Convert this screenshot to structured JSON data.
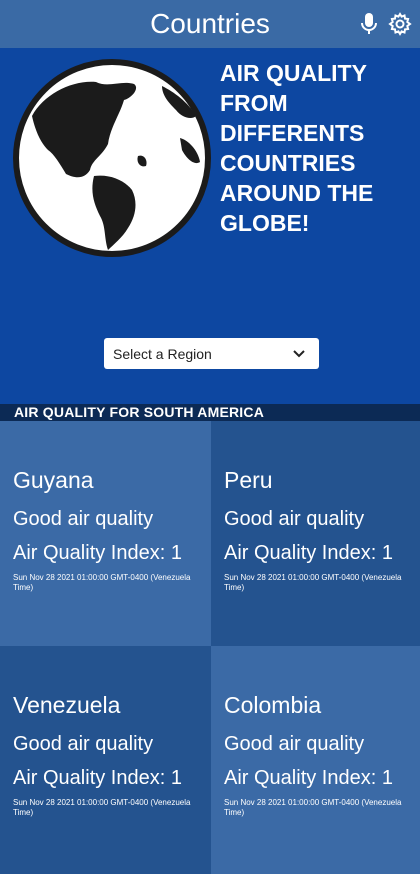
{
  "header": {
    "title": "Countries",
    "icons": [
      "microphone-icon",
      "gear-icon"
    ]
  },
  "hero": {
    "heading": "AIR QUALITY FROM DIFFERENTS COUNTRIES AROUND THE GLOBE!",
    "select": {
      "value": "Select a Region"
    }
  },
  "section": {
    "title": "AIR QUALITY FOR SOUTH AMERICA"
  },
  "cards": [
    {
      "name": "Guyana",
      "quality": "Good air quality",
      "index": "Air Quality Index: 1",
      "date": "Sun Nov 28 2021 01:00:00 GMT-0400 (Venezuela Time)"
    },
    {
      "name": "Peru",
      "quality": "Good air quality",
      "index": "Air Quality Index: 1",
      "date": "Sun Nov 28 2021 01:00:00 GMT-0400 (Venezuela Time)"
    },
    {
      "name": "Venezuela",
      "quality": "Good air quality",
      "index": "Air Quality Index: 1",
      "date": "Sun Nov 28 2021 01:00:00 GMT-0400 (Venezuela Time)"
    },
    {
      "name": "Colombia",
      "quality": "Good air quality",
      "index": "Air Quality Index: 1",
      "date": "Sun Nov 28 2021 01:00:00 GMT-0400 (Venezuela Time)"
    }
  ],
  "colors": {
    "header": "#3a6aa5",
    "hero": "#0d47a1",
    "band": "#0c2a55",
    "card_light": "#3b6aa6",
    "card_dark": "#24538f"
  }
}
